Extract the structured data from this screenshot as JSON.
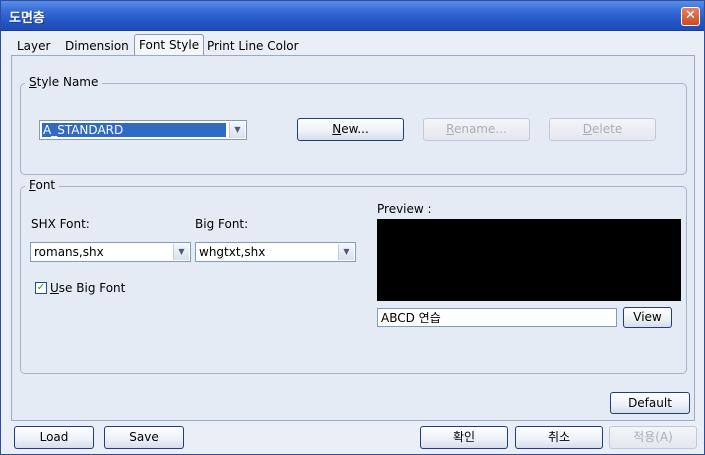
{
  "window": {
    "title": "도면층",
    "close_glyph": "✕"
  },
  "tabs": [
    {
      "label": "Layer"
    },
    {
      "label": "Dimension"
    },
    {
      "label": "Font Style"
    },
    {
      "label": "Print Line Color"
    }
  ],
  "style_name_group": {
    "legend_prefix": "S",
    "legend_rest": "tyle Name",
    "combo_value": "A_STANDARD",
    "new_button": {
      "prefix": "N",
      "rest": "ew..."
    },
    "rename_button": {
      "prefix": "R",
      "rest": "ename..."
    },
    "delete_button": {
      "prefix": "D",
      "rest": "elete"
    }
  },
  "font_group": {
    "legend_prefix": "F",
    "legend_rest": "ont",
    "shx_label": "SHX Font:",
    "shx_value": "romans,shx",
    "big_label": "Big Font:",
    "big_value": "whgtxt,shx",
    "use_big_font": {
      "checked": true,
      "prefix": "U",
      "rest": "se Big Font",
      "check_glyph": "✓"
    },
    "preview_label": "Preview :",
    "preview_text": "ABCD 연습",
    "view_button": "View"
  },
  "footer": {
    "default_button": "Default",
    "load_button": "Load",
    "save_button": "Save",
    "ok_button": "확인",
    "cancel_button": "취소",
    "apply_button": "적용(A)"
  },
  "icons": {
    "dropdown_arrow": "▼"
  }
}
